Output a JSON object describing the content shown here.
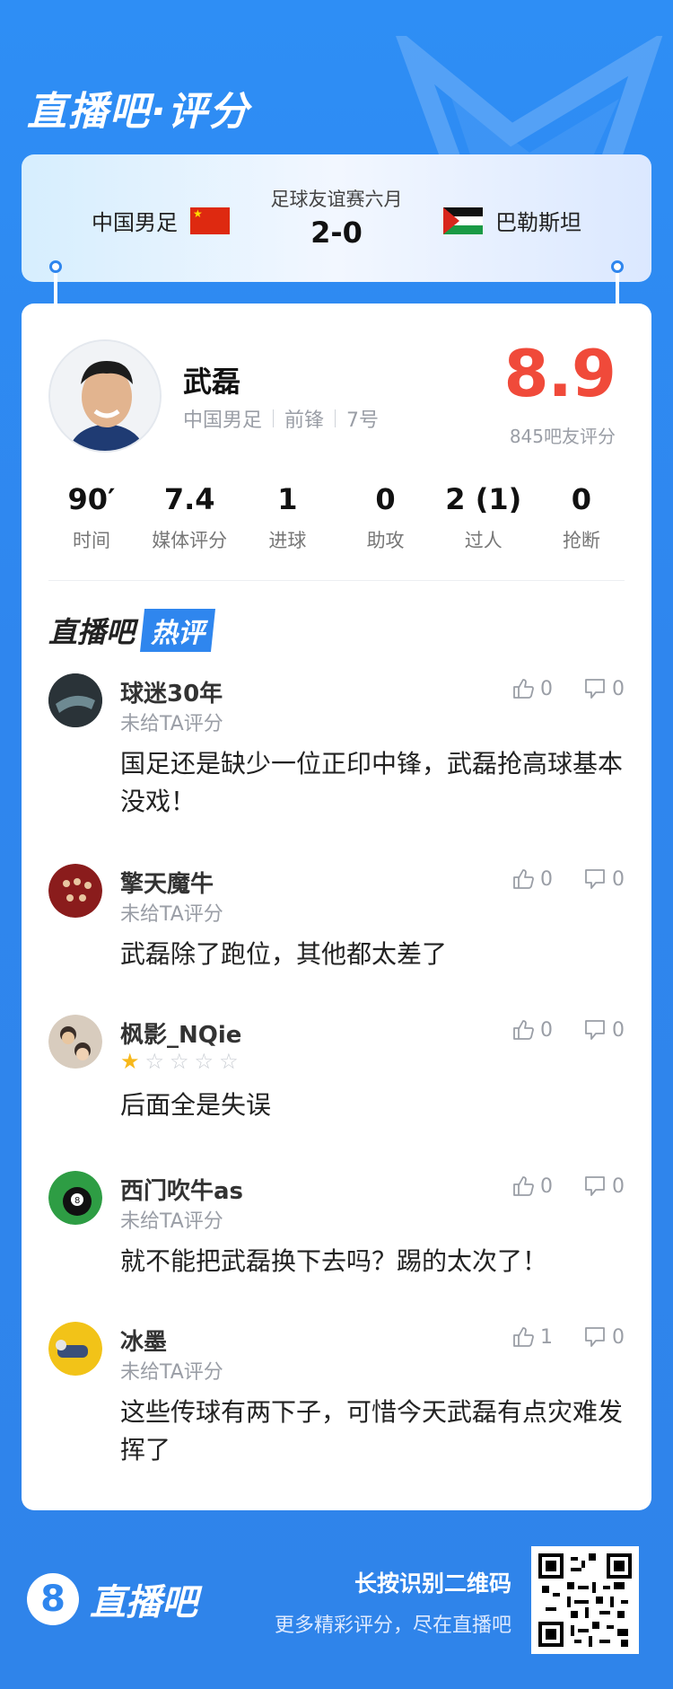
{
  "header": {
    "title": "直播吧·评分"
  },
  "match": {
    "home_team": "中国男足",
    "away_team": "巴勒斯坦",
    "league": "足球友谊赛六月",
    "score": "2-0"
  },
  "player": {
    "name": "武磊",
    "team": "中国男足",
    "position": "前锋",
    "number": "7号",
    "rating": "8.9",
    "rating_note": "845吧友评分"
  },
  "stats": [
    {
      "value": "90′",
      "label": "时间"
    },
    {
      "value": "7.4",
      "label": "媒体评分"
    },
    {
      "value": "1",
      "label": "进球"
    },
    {
      "value": "0",
      "label": "助攻"
    },
    {
      "value": "2 (1)",
      "label": "过人"
    },
    {
      "value": "0",
      "label": "抢断"
    }
  ],
  "hot": {
    "label_a": "直播吧",
    "label_b": "热评"
  },
  "comments": [
    {
      "user": "球迷30年",
      "sub": "未给TA评分",
      "text": "国足还是缺少一位正印中锋，武磊抢高球基本没戏！",
      "likes": "0",
      "dislikes": "0",
      "avatar_color": "#2a3338"
    },
    {
      "user": "擎天魔牛",
      "sub": "未给TA评分",
      "text": "武磊除了跑位，其他都太差了",
      "likes": "0",
      "dislikes": "0",
      "avatar_color": "#8a1c1c"
    },
    {
      "user": "枫影_NQie",
      "stars": 1,
      "stars_total": 5,
      "text": "后面全是失误",
      "likes": "0",
      "dislikes": "0",
      "avatar_color": "#c9b9a8"
    },
    {
      "user": "西门吹牛as",
      "sub": "未给TA评分",
      "text": "就不能把武磊换下去吗？踢的太次了！",
      "likes": "0",
      "dislikes": "0",
      "avatar_color": "#2e9d44"
    },
    {
      "user": "冰墨",
      "sub": "未给TA评分",
      "text": "这些传球有两下子，可惜今天武磊有点灾难发挥了",
      "likes": "1",
      "dislikes": "0",
      "avatar_color": "#f2c318"
    }
  ],
  "footer": {
    "logo_glyph": "8",
    "logo_text": "直播吧",
    "qr_hint": "长按识别二维码",
    "qr_sub": "更多精彩评分，尽在直播吧"
  },
  "colors": {
    "brand_blue": "#2f86ee",
    "rating_red": "#f04a3a",
    "star_gold": "#f7b81b"
  }
}
